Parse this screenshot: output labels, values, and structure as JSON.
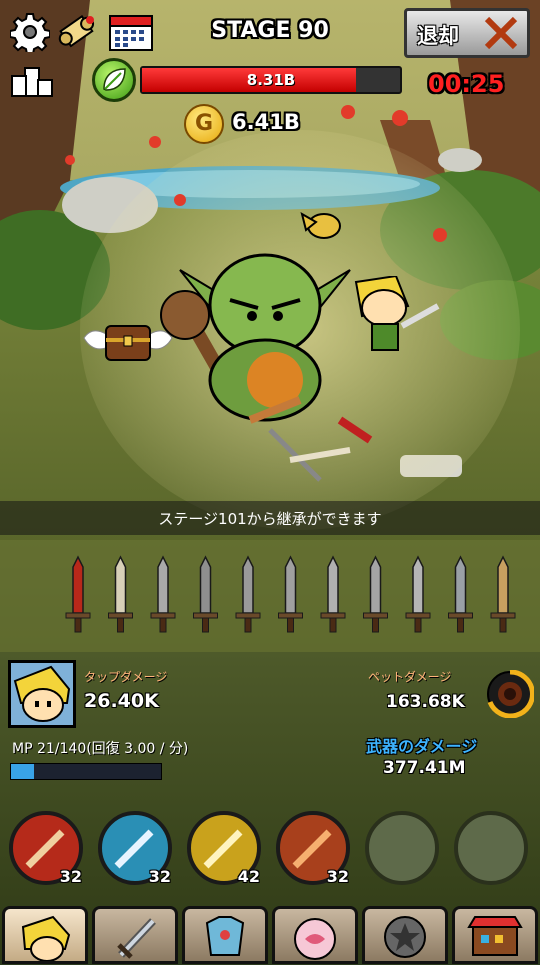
{
  "hud": {
    "stage_title": "STAGE 90",
    "boss_hp": "8.31B",
    "boss_hp_fraction": 0.83,
    "timer": "00:25",
    "gold": "6.41B",
    "gold_coin_letter": "G",
    "retreat_label": "退却"
  },
  "banner": {
    "inherit_message": "ステージ101から継承ができます"
  },
  "weapons": {
    "count": 11
  },
  "stats": {
    "tap_damage_label": "タップダメージ",
    "tap_damage_value": "26.40K",
    "pet_damage_label": "ペットダメージ",
    "pet_damage_value": "163.68K",
    "mp_text": "MP 21/140(回復 3.00 / 分)",
    "mp_fraction": 0.15,
    "weapon_damage_label": "武器のダメージ",
    "weapon_damage_value": "377.41M"
  },
  "skills": [
    {
      "level": "32",
      "color": "#b52a1a"
    },
    {
      "level": "32",
      "color": "#2a8fb5"
    },
    {
      "level": "42",
      "color": "#c9a21c"
    },
    {
      "level": "32",
      "color": "#a8401c"
    },
    {
      "level": "",
      "color": "#5e6a4a"
    },
    {
      "level": "",
      "color": "#5e6a4a"
    }
  ],
  "colors": {
    "hp_red": "#e01010",
    "timer_red": "#ff2020",
    "mp_blue": "#39a3e8",
    "weapon_damage_blue": "#3db4ff"
  }
}
